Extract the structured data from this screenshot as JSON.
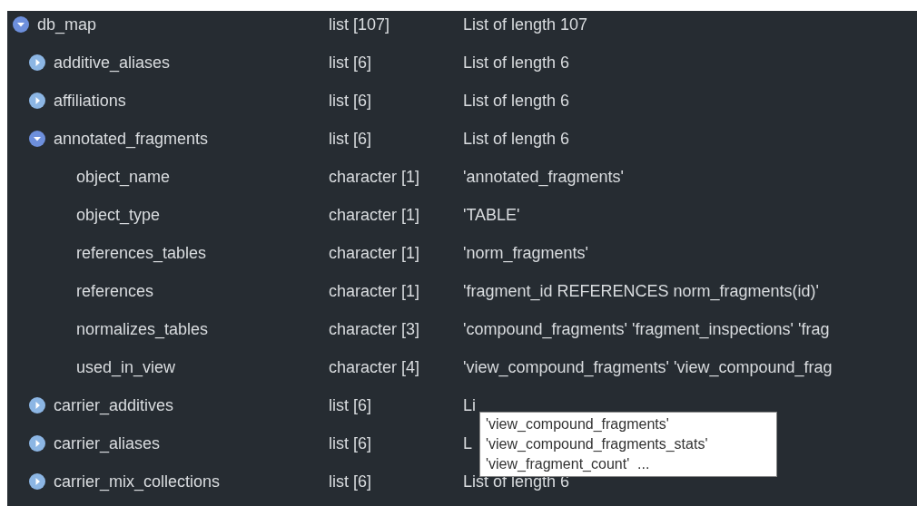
{
  "tree": [
    {
      "name": "db_map",
      "type": "list [107]",
      "value": "List of length 107",
      "expanded": true,
      "children": [
        {
          "name": "additive_aliases",
          "type": "list [6]",
          "value": "List of length 6",
          "expanded": false
        },
        {
          "name": "affiliations",
          "type": "list [6]",
          "value": "List of length 6",
          "expanded": false
        },
        {
          "name": "annotated_fragments",
          "type": "list [6]",
          "value": "List of length 6",
          "expanded": true,
          "children": [
            {
              "name": "object_name",
              "type": "character [1]",
              "value": "'annotated_fragments'"
            },
            {
              "name": "object_type",
              "type": "character [1]",
              "value": "'TABLE'"
            },
            {
              "name": "references_tables",
              "type": "character [1]",
              "value": "'norm_fragments'"
            },
            {
              "name": "references",
              "type": "character [1]",
              "value": "'fragment_id REFERENCES norm_fragments(id)'"
            },
            {
              "name": "normalizes_tables",
              "type": "character [3]",
              "value": "'compound_fragments' 'fragment_inspections' 'frag"
            },
            {
              "name": "used_in_view",
              "type": "character [4]",
              "value": "'view_compound_fragments' 'view_compound_frag"
            }
          ]
        },
        {
          "name": "carrier_additives",
          "type": "list [6]",
          "value": "Li",
          "expanded": false
        },
        {
          "name": "carrier_aliases",
          "type": "list [6]",
          "value": "L",
          "expanded": false
        },
        {
          "name": "carrier_mix_collections",
          "type": "list [6]",
          "value": "List of length 6",
          "expanded": false
        }
      ]
    }
  ],
  "tooltip": {
    "lines": [
      "'view_compound_fragments'",
      "'view_compound_fragments_stats'",
      "'view_fragment_count'  ..."
    ]
  }
}
